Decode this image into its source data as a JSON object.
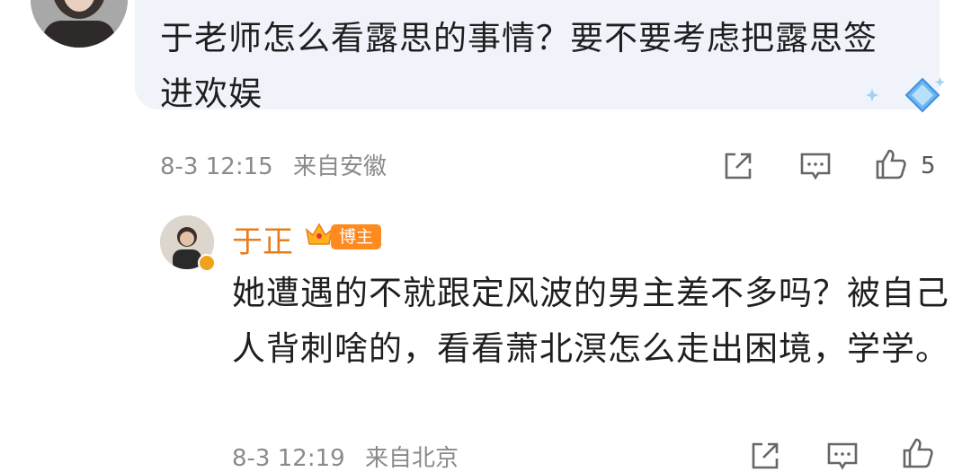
{
  "comment": {
    "text": "于老师怎么看露思的事情？要不要考虑把露思签进欢娱",
    "date": "8-3 12:15",
    "location": "来自安徽",
    "like_count": "5"
  },
  "reply": {
    "author": "于正",
    "author_tag": "博主",
    "text": "她遭遇的不就跟定风波的男主差不多吗？被自己人背刺啥的，看看萧北溟怎么走出困境，学学。",
    "date": "8-3 12:19",
    "location": "来自北京"
  },
  "icons": {
    "share": "share-icon",
    "comment": "comment-icon",
    "like": "thumbs-up-icon",
    "badge": "diamond-badge-icon",
    "crown": "crown-icon",
    "verified": "verified-badge-icon"
  },
  "colors": {
    "bubble_bg": "#f1f3fb",
    "author_name": "#e87d1e",
    "tag_bg": "#ff8a1f",
    "meta_text": "#8a8a8a"
  }
}
